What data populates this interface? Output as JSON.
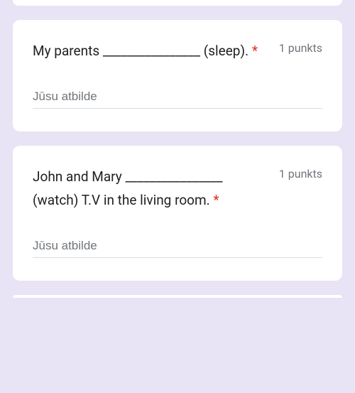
{
  "questions": [
    {
      "text_before": "My parents ________________ (sleep).",
      "required_marker": " *",
      "points_label": "1 punkts",
      "answer_placeholder": "Jūsu atbilde"
    },
    {
      "text_before": "John and Mary ________________ (watch) T.V in the living room.",
      "required_marker": " *",
      "points_label": "1 punkts",
      "answer_placeholder": "Jūsu atbilde"
    }
  ]
}
